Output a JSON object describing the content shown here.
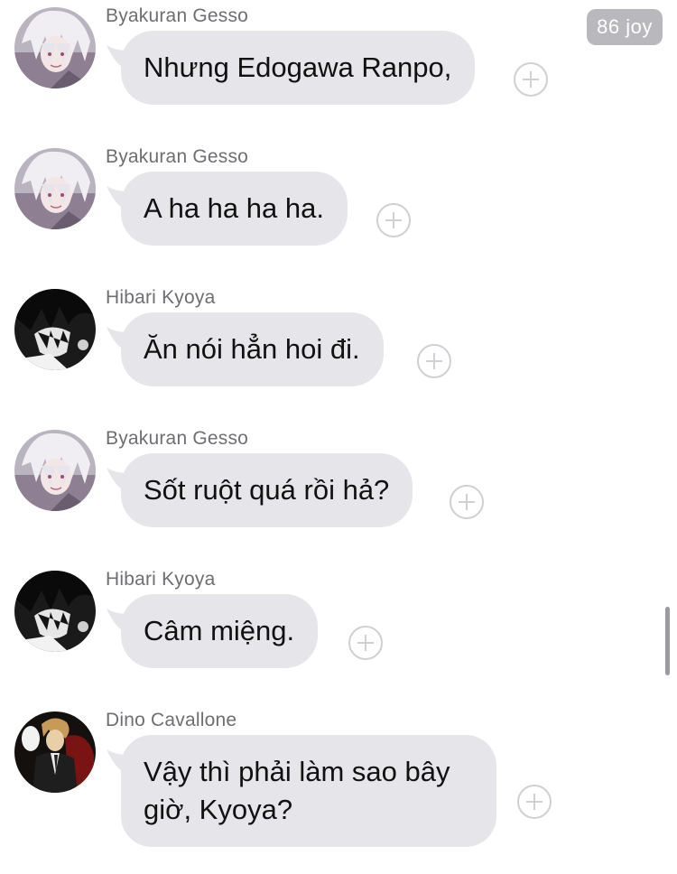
{
  "badge": {
    "label": "86 joy"
  },
  "messages": [
    {
      "sender": "Byakuran Gesso",
      "text": "Nhưng Edogawa Ranpo,",
      "avatar": "byakuran-avatar"
    },
    {
      "sender": "Byakuran Gesso",
      "text": "A ha ha ha ha.",
      "avatar": "byakuran-avatar"
    },
    {
      "sender": "Hibari Kyoya",
      "text": "Ăn nói hẳn hoi đi.",
      "avatar": "hibari-avatar"
    },
    {
      "sender": "Byakuran Gesso",
      "text": "Sốt ruột quá rồi hả?",
      "avatar": "byakuran-avatar"
    },
    {
      "sender": "Hibari Kyoya",
      "text": "Câm miệng.",
      "avatar": "hibari-avatar"
    },
    {
      "sender": "Dino Cavallone",
      "text": "Vậy thì phải làm sao bây giờ, Kyoya?",
      "avatar": "dino-avatar"
    }
  ],
  "icons": {
    "react": "add-reaction-icon"
  },
  "colors": {
    "bubble": "#e5e5ea",
    "sender": "#6e6e73",
    "badge": "#b9b9bd",
    "react_border": "#cfcfd4"
  }
}
